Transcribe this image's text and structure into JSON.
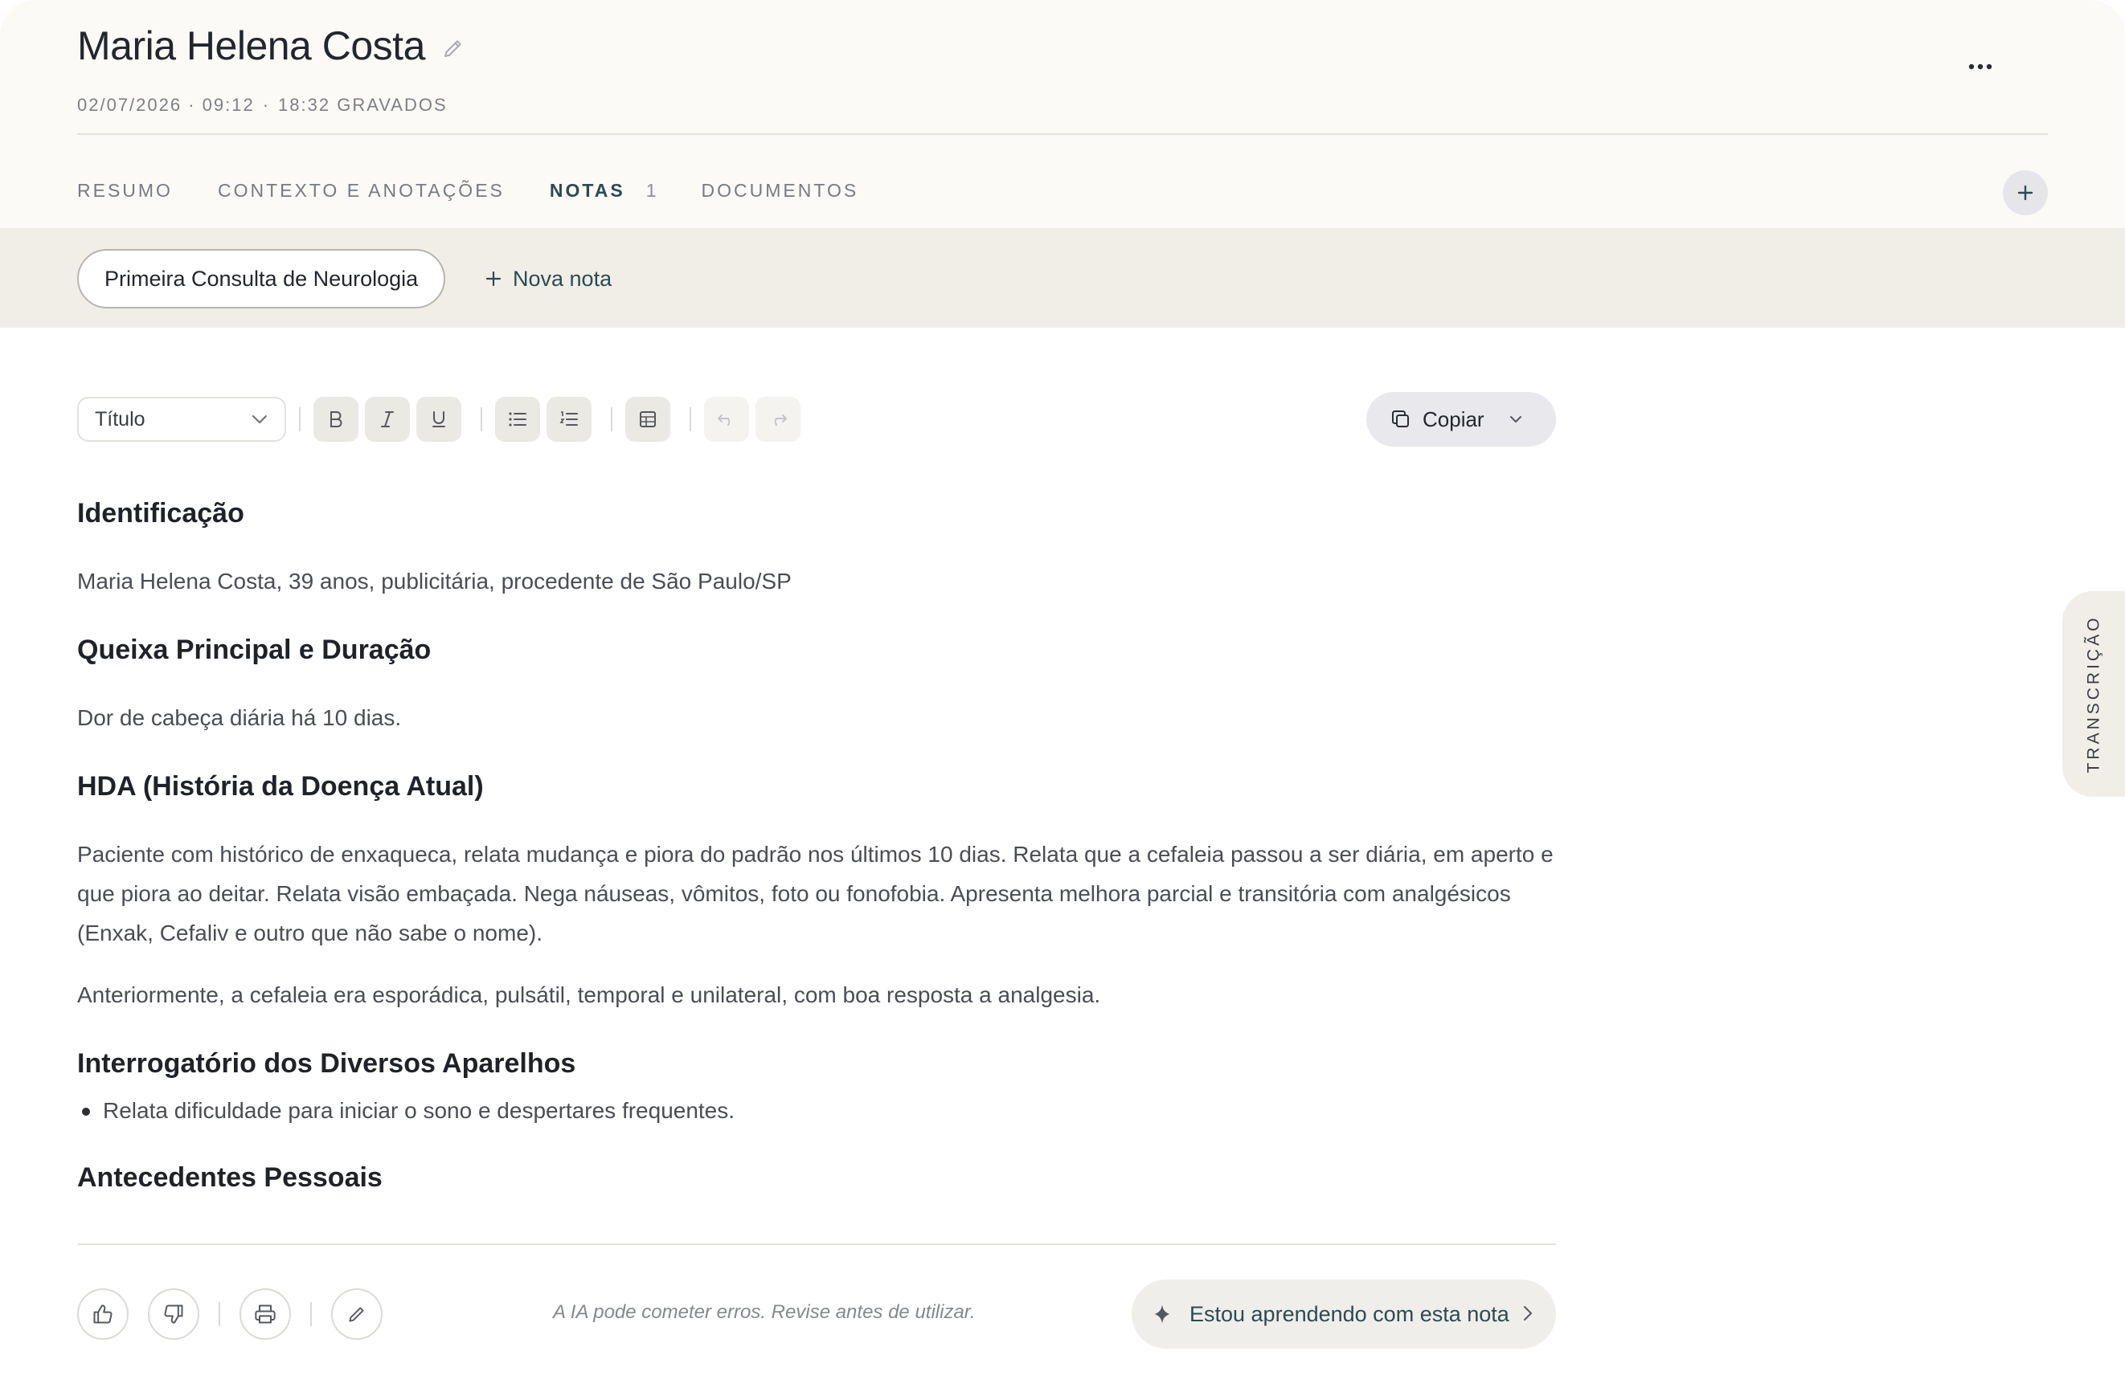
{
  "header": {
    "patient_name": "Maria Helena Costa",
    "date_time": "02/07/2026 · 09:12",
    "meta_separator": "·",
    "recorded": "18:32 GRAVADOS"
  },
  "tabs": [
    {
      "label": "RESUMO"
    },
    {
      "label": "CONTEXTO E ANOTAÇÕES"
    },
    {
      "label": "NOTAS",
      "count": "1"
    },
    {
      "label": "DOCUMENTOS"
    }
  ],
  "notes_strip": {
    "active_note": "Primeira Consulta de Neurologia",
    "new_note_label": "Nova nota"
  },
  "toolbar": {
    "style_select_value": "Título",
    "copy_label": "Copiar"
  },
  "note": {
    "sections": [
      {
        "heading": "Identificação",
        "paragraphs": [
          "Maria Helena Costa, 39 anos, publicitária, procedente de São Paulo/SP"
        ]
      },
      {
        "heading": "Queixa Principal e Duração",
        "paragraphs": [
          "Dor de cabeça diária há 10 dias."
        ]
      },
      {
        "heading": "HDA (História da Doença Atual)",
        "paragraphs": [
          "Paciente com histórico de enxaqueca, relata mudança e piora do padrão nos últimos 10 dias. Relata que a cefaleia passou a ser diária, em aperto e que piora ao deitar. Relata visão embaçada. Nega náuseas, vômitos, foto ou fonofobia. Apresenta melhora parcial e transitória com analgésicos (Enxak, Cefaliv e outro que não sabe o nome).",
          "Anteriormente, a cefaleia era esporádica, pulsátil, temporal e unilateral, com boa resposta a analgesia."
        ]
      },
      {
        "heading": "Interrogatório dos Diversos Aparelhos",
        "bullets": [
          "Relata dificuldade para iniciar o sono e despertares frequentes."
        ]
      }
    ],
    "cut_off_heading": "Antecedentes Pessoais"
  },
  "footer": {
    "disclaimer": "A IA pode cometer erros. Revise antes de utilizar.",
    "learn_label": "Estou aprendendo com esta nota"
  },
  "side_tab": {
    "label": "TRANSCRIÇÃO"
  },
  "colors": {
    "accent": "#2c4a52",
    "header_bg": "#fbfaf7",
    "strip_bg": "#f1eee8"
  },
  "icons": [
    "pencil-icon",
    "more-icon",
    "plus-icon",
    "chevron-down-icon",
    "bold-icon",
    "italic-icon",
    "underline-icon",
    "bullet-list-icon",
    "numbered-list-icon",
    "table-icon",
    "undo-icon",
    "redo-icon",
    "copy-icon",
    "thumbs-up-icon",
    "thumbs-down-icon",
    "print-icon",
    "sparkle-icon",
    "chevron-right-icon"
  ]
}
